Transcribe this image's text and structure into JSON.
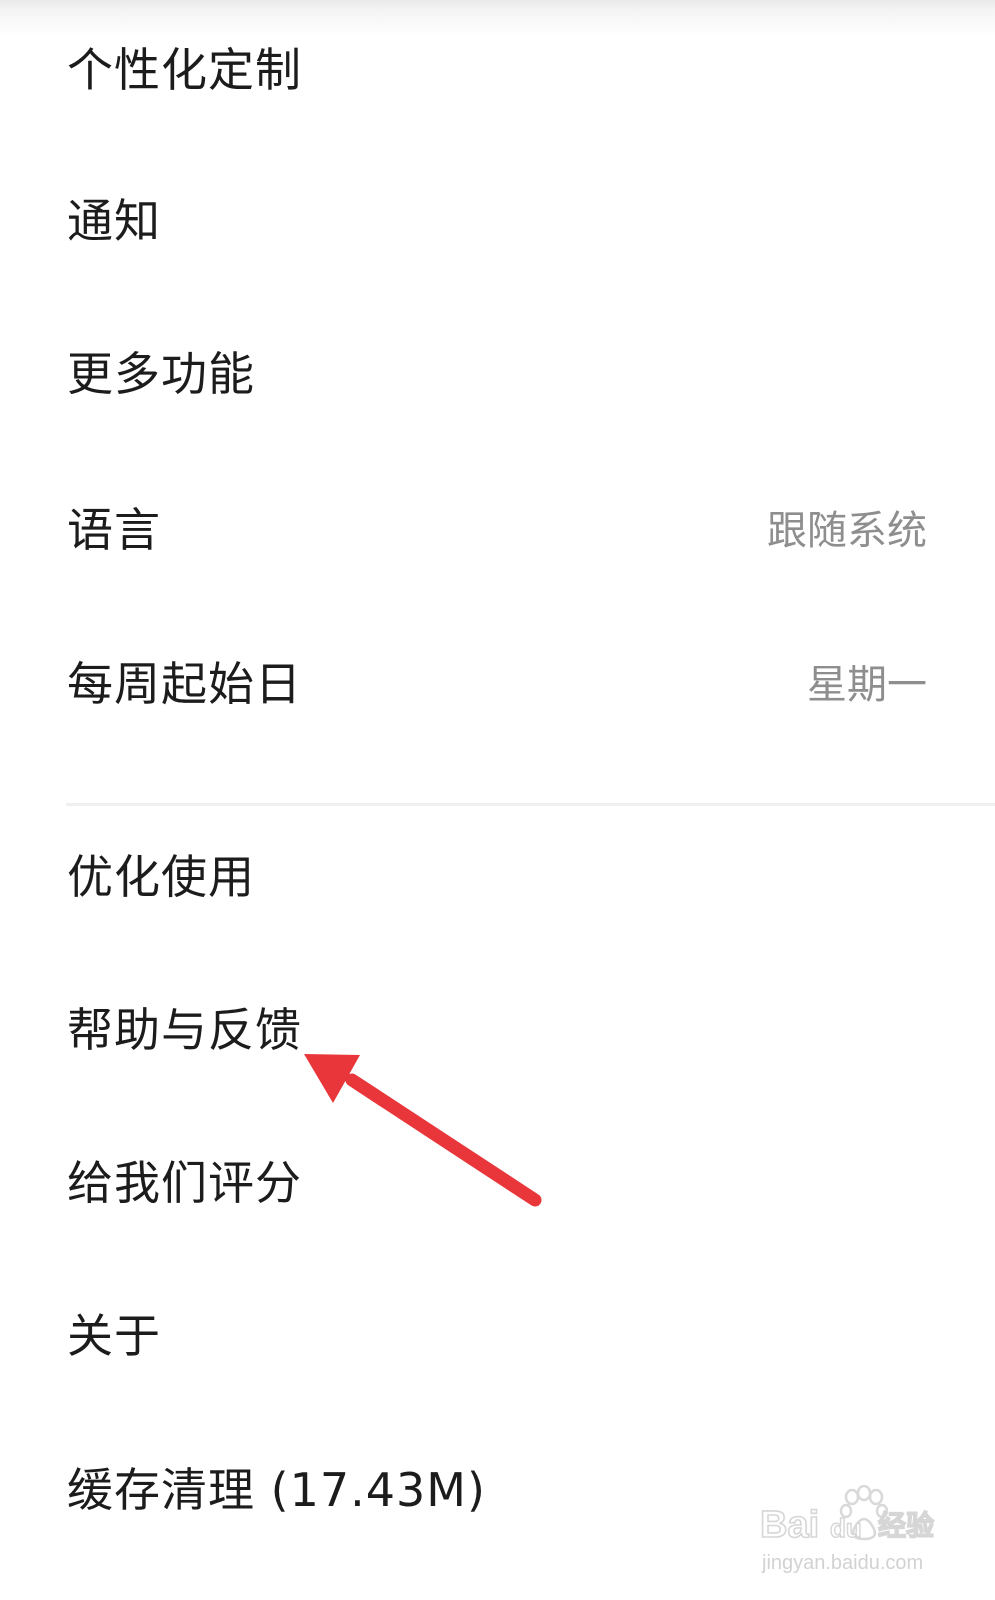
{
  "settings": {
    "items": [
      {
        "label": "个性化定制"
      },
      {
        "label": "通知"
      },
      {
        "label": "更多功能"
      },
      {
        "label": "语言",
        "value": "跟随系统"
      },
      {
        "label": "每周起始日",
        "value": "星期一"
      },
      {
        "label": "优化使用"
      },
      {
        "label": "帮助与反馈"
      },
      {
        "label": "给我们评分"
      },
      {
        "label": "关于"
      },
      {
        "label": "缓存清理 (17.43M)"
      }
    ]
  },
  "annotation": {
    "arrow_color": "#e8363a",
    "arrow_target": "帮助与反馈"
  },
  "watermark": {
    "logo": "Bai du 经验",
    "url": "jingyan.baidu.com"
  },
  "colors": {
    "background": "#ffffff",
    "text_primary": "#1c1c1c",
    "text_secondary": "#8e8e8e",
    "divider": "#f0f0f0"
  }
}
